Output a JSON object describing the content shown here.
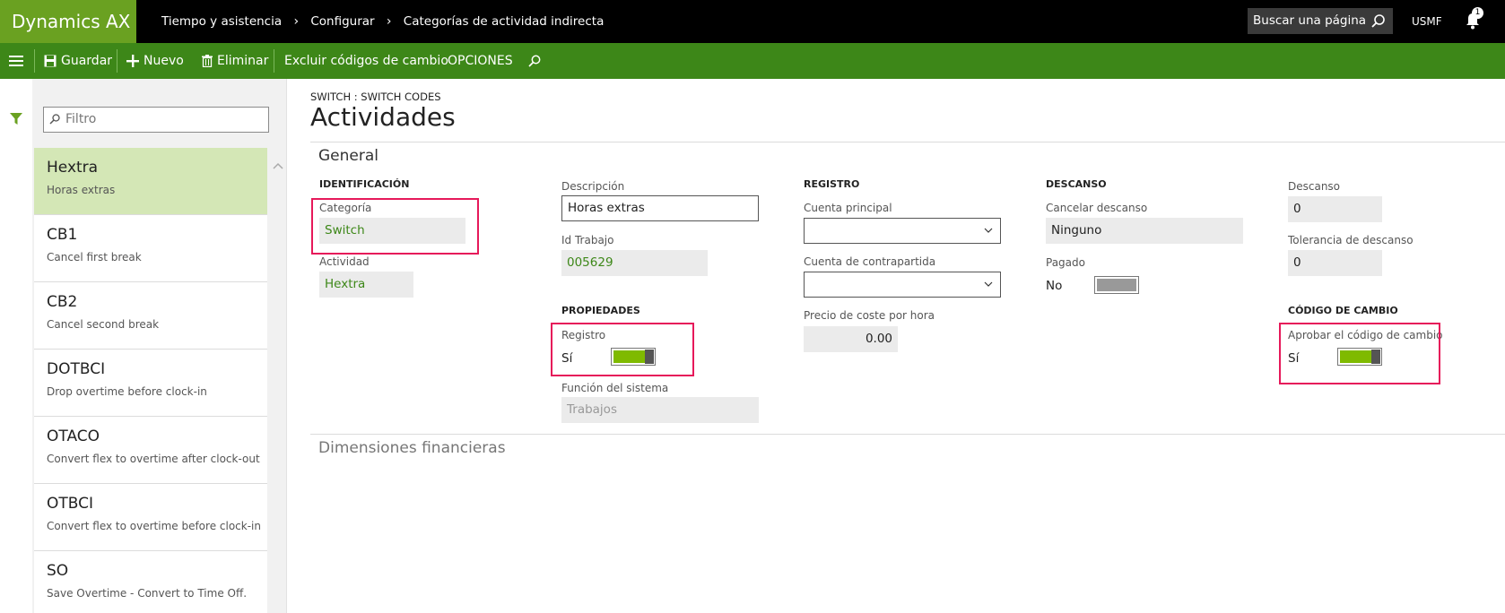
{
  "app": {
    "name": "Dynamics AX"
  },
  "breadcrumb": [
    "Tiempo y asistencia",
    "Configurar",
    "Categorías de actividad indirecta"
  ],
  "search": {
    "placeholder": "Buscar una página"
  },
  "company": "USMF",
  "notifications": {
    "count": "1"
  },
  "toolbar": {
    "save": "Guardar",
    "new": "Nuevo",
    "delete": "Eliminar",
    "exclude": "Excluir códigos de cambio",
    "options": "OPCIONES"
  },
  "filter": {
    "placeholder": "Filtro"
  },
  "list": [
    {
      "title": "Hextra",
      "subtitle": "Horas extras",
      "selected": true
    },
    {
      "title": "CB1",
      "subtitle": "Cancel first break"
    },
    {
      "title": "CB2",
      "subtitle": "Cancel second break"
    },
    {
      "title": "DOTBCI",
      "subtitle": "Drop overtime before clock-in"
    },
    {
      "title": "OTACO",
      "subtitle": "Convert flex to overtime after clock-out"
    },
    {
      "title": "OTBCI",
      "subtitle": "Convert flex to overtime before clock-in"
    },
    {
      "title": "SO",
      "subtitle": "Save Overtime - Convert to Time Off."
    }
  ],
  "page": {
    "caption": "SWITCH : SWITCH CODES",
    "title": "Actividades"
  },
  "general": {
    "title": "General",
    "identification": {
      "heading": "IDENTIFICACIÓN",
      "category_label": "Categoría",
      "category_value": "Switch",
      "activity_label": "Actividad",
      "activity_value": "Hextra"
    },
    "description": {
      "label": "Descripción",
      "value": "Horas extras",
      "job_label": "Id Trabajo",
      "job_value": "005629"
    },
    "properties": {
      "heading": "PROPIEDADES",
      "register_label": "Registro",
      "register_value": "Sí",
      "register_on": true,
      "function_label": "Función del sistema",
      "function_value": "Trabajos"
    },
    "registration": {
      "heading": "REGISTRO",
      "main_account_label": "Cuenta principal",
      "main_account_value": "",
      "offset_account_label": "Cuenta de contrapartida",
      "offset_account_value": "",
      "cost_label": "Precio de coste por hora",
      "cost_value": "0.00"
    },
    "break": {
      "heading": "DESCANSO",
      "cancel_label": "Cancelar descanso",
      "cancel_value": "Ninguno",
      "paid_label": "Pagado",
      "paid_value": "No",
      "paid_on": false
    },
    "break2": {
      "break_label": "Descanso",
      "break_value": "0",
      "tolerance_label": "Tolerancia de descanso",
      "tolerance_value": "0"
    },
    "switch_code": {
      "heading": "CÓDIGO DE CAMBIO",
      "approve_label": "Aprobar el código de cambio",
      "approve_value": "Sí",
      "approve_on": true
    }
  },
  "financial": {
    "title": "Dimensiones financieras"
  },
  "colors": {
    "brand": "#6aa121",
    "action_bar": "#3d8718",
    "toggle_on": "#7fba00",
    "highlight": "#e6195a"
  }
}
